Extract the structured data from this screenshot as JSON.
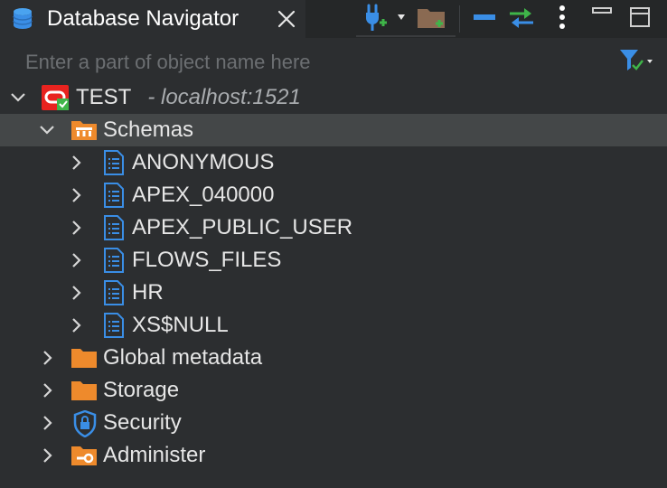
{
  "tab": {
    "title": "Database Navigator"
  },
  "search": {
    "placeholder": "Enter a part of object name here",
    "value": ""
  },
  "connection": {
    "name": "TEST",
    "host": "- localhost:1521"
  },
  "tree": {
    "schemas_label": "Schemas",
    "schemas": [
      "ANONYMOUS",
      "APEX_040000",
      "APEX_PUBLIC_USER",
      "FLOWS_FILES",
      "HR",
      "XS$NULL"
    ],
    "folders": [
      "Global metadata",
      "Storage",
      "Security",
      "Administer"
    ]
  },
  "colors": {
    "accent": "#3a8ee6",
    "folder": "#ee8a2c",
    "oracle_red": "#e8231f",
    "add_green": "#3fb549",
    "selected_row": "#444748"
  },
  "icons": {
    "tab": "database-icon",
    "close": "close-icon",
    "connect": "connect-plugin-icon",
    "new_folder": "new-folder-icon",
    "collapse": "collapse-all-icon",
    "link": "link-editor-icon",
    "menu": "kebab-menu-icon",
    "minimize": "minimize-icon",
    "maximize": "maximize-icon",
    "filter": "filter-icon"
  }
}
